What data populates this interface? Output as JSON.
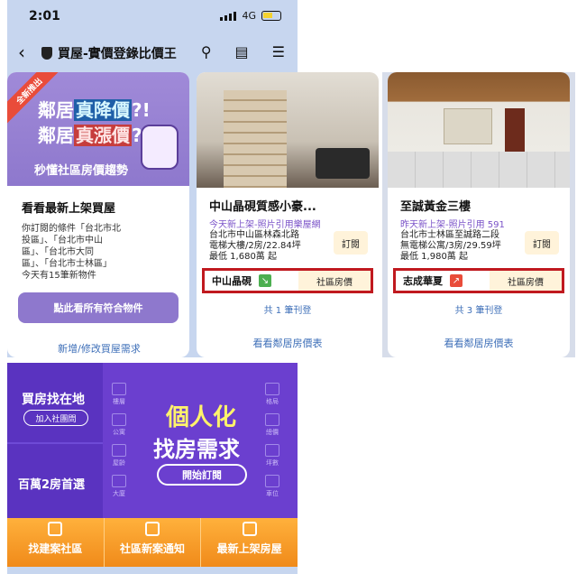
{
  "status_bar": {
    "time": "2:01",
    "network": "4G"
  },
  "nav": {
    "back": "‹",
    "title": "買屋-實價登錄比價王"
  },
  "promo": {
    "ribbon": "全新推出",
    "line1_prefix": "鄰居",
    "line1_hl": "真降價",
    "line1_suffix": "?!",
    "line2_prefix": "鄰居",
    "line2_hl": "真漲價",
    "line2_suffix": "?!",
    "subtitle": "秒懂社區房價趨勢"
  },
  "saved_search": {
    "heading": "看看最新上架買屋",
    "desc1": "你訂閱的條件「台北市北",
    "desc2": "投區」、「台北市中山",
    "desc3": "區」、「台北市大同",
    "desc4": "區」、「台北市士林區」",
    "desc5": "今天有15筆新物件",
    "button": "點此看所有符合物件",
    "link": "新增/修改買屋需求"
  },
  "listings": [
    {
      "name": "中山晶硯質感小豪...",
      "tag": "今天新上架-照片引用樂屋網",
      "addr": "台北市中山區林森北路",
      "spec": "電梯大樓/2房/22.84坪",
      "price": "最低 1,680萬 起",
      "subscribe": "訂閱",
      "community": "中山晶硯",
      "trend": "down",
      "price_btn": "社區房價",
      "count": "共 1 筆刊登",
      "see_all": "看看鄰居房價表"
    },
    {
      "name": "至誠黃金三樓",
      "tag": "昨天新上架-照片引用 591",
      "addr": "台北市士林區至誠路二段",
      "spec": "無電梯公寓/3房/29.59坪",
      "price": "最低 1,980萬 起",
      "subscribe": "訂閱",
      "community": "志成華夏",
      "trend": "up",
      "price_btn": "社區房價",
      "count": "共 3 筆刊登",
      "see_all": "看看鄰居房價表"
    }
  ],
  "banner": {
    "left_title": "買房找在地",
    "join": "加入社團問",
    "left_bottom": "百萬2房首選",
    "left_icons": [
      "樓層",
      "公寓",
      "屋齡",
      "大廈"
    ],
    "right_icons": [
      "車位",
      "坪數",
      "總價",
      "格局"
    ],
    "big1": "個人化",
    "big2": "找房需求",
    "cta": "開始訂閱"
  },
  "tabs": [
    "找建案社區",
    "社區新案通知",
    "最新上架房屋"
  ]
}
